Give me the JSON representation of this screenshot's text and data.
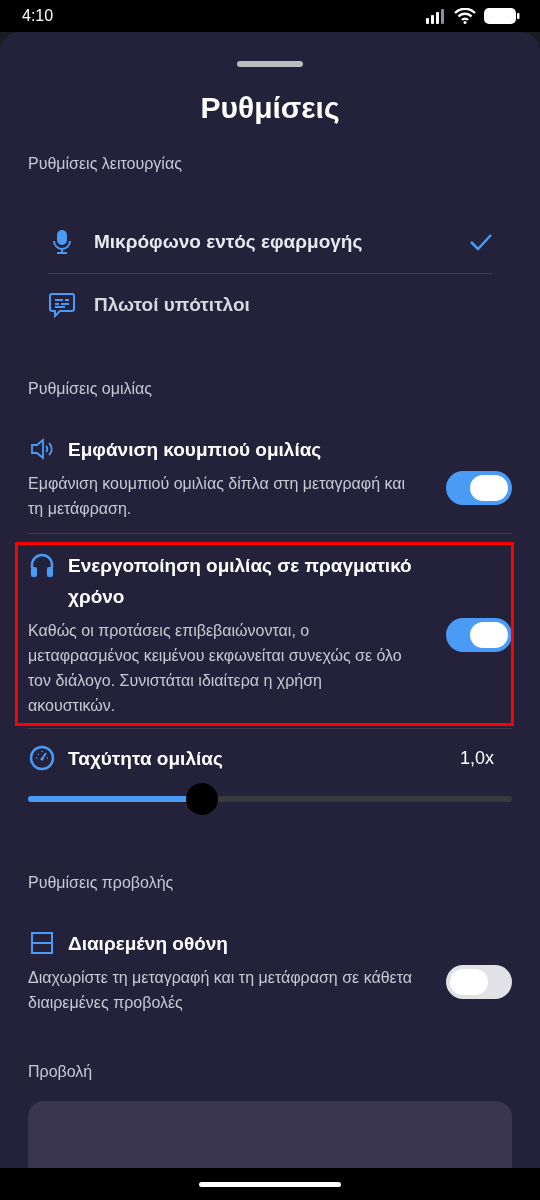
{
  "status_bar": {
    "time": "4:10"
  },
  "title": "Ρυθμίσεις",
  "sections": [
    {
      "kind": "options",
      "heading": "Ρυθμίσεις λειτουργίας",
      "options": [
        {
          "label": "Μικρόφωνο εντός εφαρμογής",
          "selected": true
        },
        {
          "label": "Πλωτοί υπότιτλοι",
          "selected": false
        }
      ]
    },
    {
      "kind": "settings",
      "heading": "Ρυθμίσεις ομιλίας",
      "items": [
        {
          "kind": "toggle",
          "title": "Εμφάνιση κουμπιού ομιλίας",
          "description": "Εμφάνιση κουμπιού ομιλίας δίπλα στη μεταγραφή και τη μετάφραση.",
          "on": true,
          "highlighted": false
        },
        {
          "kind": "toggle",
          "title": "Ενεργοποίηση ομιλίας σε πραγματικό χρόνο",
          "description": "Καθώς οι προτάσεις επιβεβαιώνονται, ο μεταφρασμένος κειμένου εκφωνείται συνεχώς σε όλο τον διάλογο. Συνιστάται ιδιαίτερα η χρήση ακουστικών.",
          "on": true,
          "highlighted": true
        },
        {
          "kind": "slider",
          "title": "Ταχύτητα ομιλίας",
          "value": "1,0x",
          "level": 0.36,
          "highlighted": false
        }
      ]
    },
    {
      "kind": "settings",
      "heading": "Ρυθμίσεις προβολής",
      "items": [
        {
          "kind": "toggle",
          "title": "Διαιρεμένη οθόνη",
          "description": "Διαχωρίστε τη μεταγραφή και τη μετάφραση σε κάθετα διαιρεμένες προβολές",
          "on": false,
          "highlighted": false
        }
      ]
    },
    {
      "kind": "card",
      "heading": "Προβολή"
    }
  ]
}
